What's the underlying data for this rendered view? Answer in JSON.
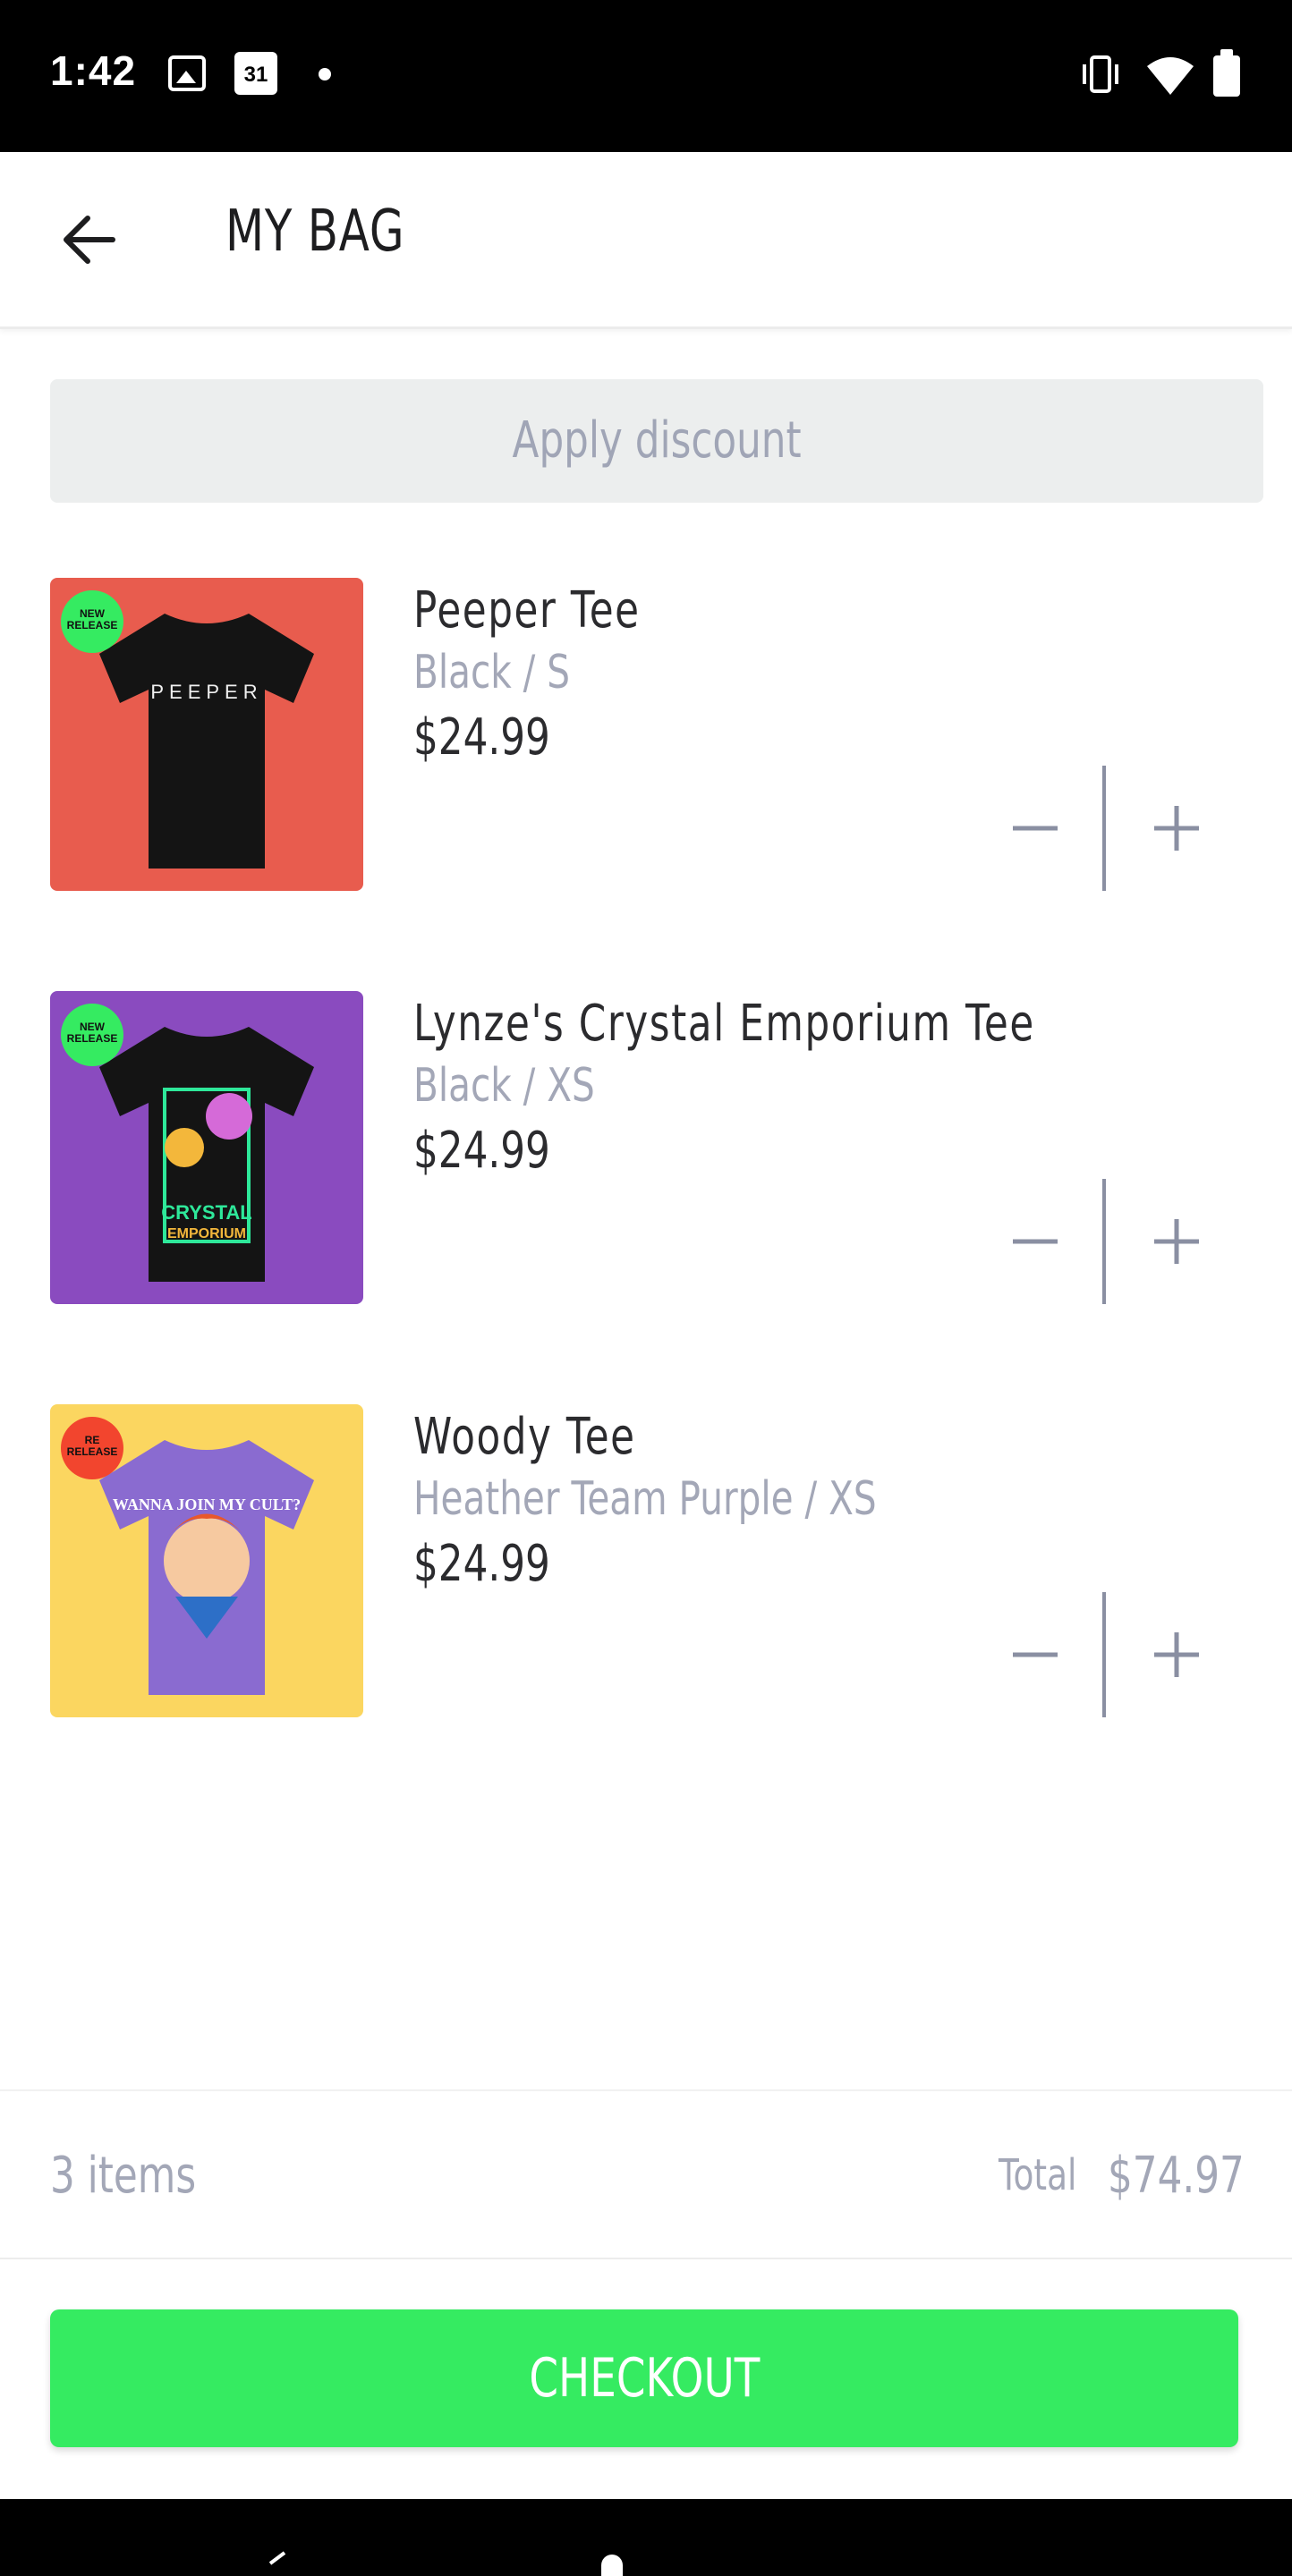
{
  "status_bar": {
    "time": "1:42",
    "calendar_day": "31",
    "icons": [
      "photo-icon",
      "calendar-icon",
      "notification-dot-icon",
      "vibrate-icon",
      "wifi-icon",
      "battery-icon"
    ]
  },
  "header": {
    "title": "MY BAG",
    "back_icon": "arrow-left-icon"
  },
  "discount": {
    "label": "Apply discount"
  },
  "items": [
    {
      "name": "Peeper Tee",
      "variant": "Black / S",
      "price": "$24.99",
      "badge": "NEW RELEASE",
      "badge_line1": "NEW",
      "badge_line2": "RELEASE",
      "shirt_text": "PEEPER",
      "bg_color": "#e85c4e",
      "shirt_color": "#141414",
      "badge_color": "#35eb61"
    },
    {
      "name": "Lynze's Crystal Emporium Tee",
      "variant": "Black / XS",
      "price": "$24.99",
      "badge": "NEW RELEASE",
      "badge_line1": "NEW",
      "badge_line2": "RELEASE",
      "shirt_text": "CRYSTAL",
      "shirt_text2": "EMPORIUM",
      "bg_color": "#8a4bbf",
      "shirt_color": "#141414",
      "badge_color": "#35eb61"
    },
    {
      "name": "Woody Tee",
      "variant": "Heather Team Purple / XS",
      "price": "$24.99",
      "badge": "RE RELEASE",
      "badge_line1": "RE",
      "badge_line2": "RELEASE",
      "shirt_text": "WANNA JOIN MY CULT?",
      "bg_color": "#fbd660",
      "shirt_color": "#8a6bd0",
      "badge_color": "#f2452e"
    }
  ],
  "summary": {
    "items_count": "3 items",
    "total_label": "Total",
    "total_value": "$74.97"
  },
  "checkout": {
    "label": "CHECKOUT",
    "color": "#35eb61"
  }
}
